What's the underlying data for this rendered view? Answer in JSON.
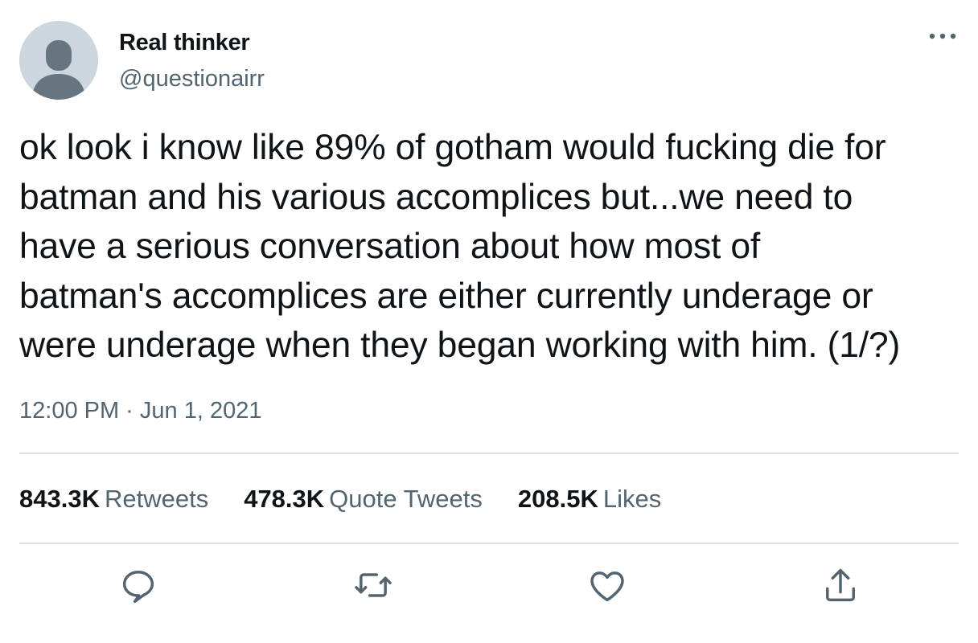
{
  "author": {
    "display_name": "Real thinker",
    "handle": "@questionairr",
    "avatar_icon": "default-avatar-icon"
  },
  "tweet": {
    "text": "ok look i know like 89% of gotham would fucking die for\nbatman and his various accomplices but...we need to\nhave a serious conversation about how most of\nbatman's accomplices are either currently underage or\nwere underage when they began working with him. (1/?)",
    "timestamp": "12:00 PM · Jun 1, 2021"
  },
  "stats": {
    "retweets_count": "843.3K",
    "retweets_label": "Retweets",
    "quotes_count": "478.3K",
    "quotes_label": "Quote Tweets",
    "likes_count": "208.5K",
    "likes_label": "Likes"
  },
  "actions": {
    "reply_icon": "reply-icon",
    "retweet_icon": "retweet-icon",
    "like_icon": "heart-icon",
    "share_icon": "share-icon",
    "more_icon": "more-options-icon"
  },
  "colors": {
    "text_primary": "#0f1419",
    "text_secondary": "#536471",
    "divider": "#dbe1e6",
    "avatar_bg": "#ccd6dd",
    "avatar_fg": "#66757f"
  }
}
